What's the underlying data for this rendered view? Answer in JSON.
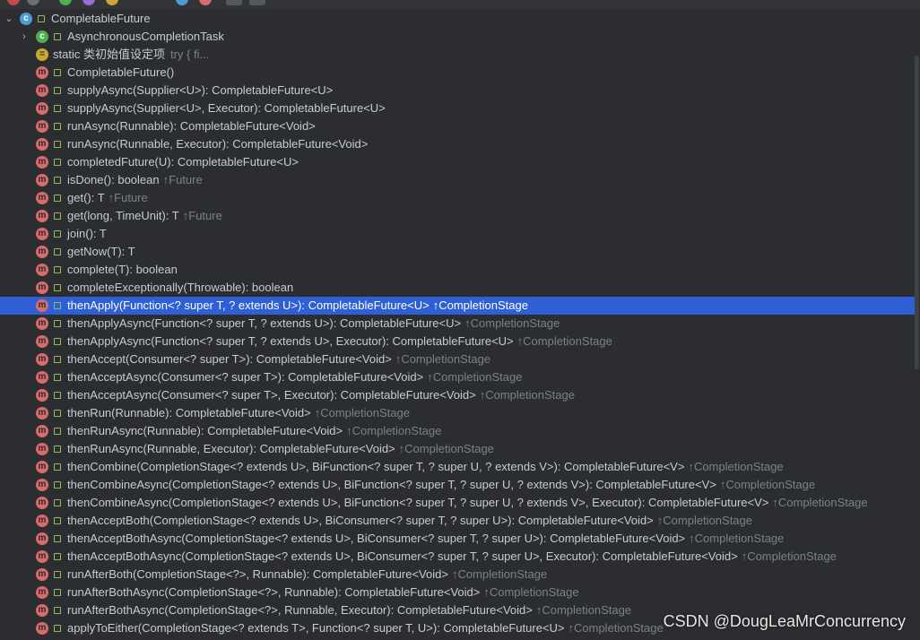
{
  "tree": {
    "root": {
      "label": "CompletableFuture",
      "icon": "class-icon"
    },
    "inner_class": {
      "label": "AsynchronousCompletionTask",
      "icon": "inner-class-icon"
    },
    "static_init": {
      "label": "static 类初始值设定项",
      "hint": "try {           fi..."
    },
    "members": [
      {
        "signature": "CompletableFuture()",
        "inherited": ""
      },
      {
        "signature": "supplyAsync(Supplier<U>): CompletableFuture<U>",
        "inherited": ""
      },
      {
        "signature": "supplyAsync(Supplier<U>, Executor): CompletableFuture<U>",
        "inherited": ""
      },
      {
        "signature": "runAsync(Runnable): CompletableFuture<Void>",
        "inherited": ""
      },
      {
        "signature": "runAsync(Runnable, Executor): CompletableFuture<Void>",
        "inherited": ""
      },
      {
        "signature": "completedFuture(U): CompletableFuture<U>",
        "inherited": ""
      },
      {
        "signature": "isDone(): boolean",
        "inherited": "↑Future"
      },
      {
        "signature": "get(): T",
        "inherited": "↑Future"
      },
      {
        "signature": "get(long, TimeUnit): T",
        "inherited": "↑Future"
      },
      {
        "signature": "join(): T",
        "inherited": ""
      },
      {
        "signature": "getNow(T): T",
        "inherited": ""
      },
      {
        "signature": "complete(T): boolean",
        "inherited": ""
      },
      {
        "signature": "completeExceptionally(Throwable): boolean",
        "inherited": ""
      },
      {
        "signature": "thenApply(Function<? super T, ? extends U>): CompletableFuture<U>",
        "inherited": "↑CompletionStage"
      },
      {
        "signature": "thenApplyAsync(Function<? super T, ? extends U>): CompletableFuture<U>",
        "inherited": "↑CompletionStage"
      },
      {
        "signature": "thenApplyAsync(Function<? super T, ? extends U>, Executor): CompletableFuture<U>",
        "inherited": "↑CompletionStage"
      },
      {
        "signature": "thenAccept(Consumer<? super T>): CompletableFuture<Void>",
        "inherited": "↑CompletionStage"
      },
      {
        "signature": "thenAcceptAsync(Consumer<? super T>): CompletableFuture<Void>",
        "inherited": "↑CompletionStage"
      },
      {
        "signature": "thenAcceptAsync(Consumer<? super T>, Executor): CompletableFuture<Void>",
        "inherited": "↑CompletionStage"
      },
      {
        "signature": "thenRun(Runnable): CompletableFuture<Void>",
        "inherited": "↑CompletionStage"
      },
      {
        "signature": "thenRunAsync(Runnable): CompletableFuture<Void>",
        "inherited": "↑CompletionStage"
      },
      {
        "signature": "thenRunAsync(Runnable, Executor): CompletableFuture<Void>",
        "inherited": "↑CompletionStage"
      },
      {
        "signature": "thenCombine(CompletionStage<? extends U>, BiFunction<? super T, ? super U, ? extends V>): CompletableFuture<V>",
        "inherited": "↑CompletionStage"
      },
      {
        "signature": "thenCombineAsync(CompletionStage<? extends U>, BiFunction<? super T, ? super U, ? extends V>): CompletableFuture<V>",
        "inherited": "↑CompletionStage"
      },
      {
        "signature": "thenCombineAsync(CompletionStage<? extends U>, BiFunction<? super T, ? super U, ? extends V>, Executor): CompletableFuture<V>",
        "inherited": "↑CompletionStage"
      },
      {
        "signature": "thenAcceptBoth(CompletionStage<? extends U>, BiConsumer<? super T, ? super U>): CompletableFuture<Void>",
        "inherited": "↑CompletionStage"
      },
      {
        "signature": "thenAcceptBothAsync(CompletionStage<? extends U>, BiConsumer<? super T, ? super U>): CompletableFuture<Void>",
        "inherited": "↑CompletionStage"
      },
      {
        "signature": "thenAcceptBothAsync(CompletionStage<? extends U>, BiConsumer<? super T, ? super U>, Executor): CompletableFuture<Void>",
        "inherited": "↑CompletionStage"
      },
      {
        "signature": "runAfterBoth(CompletionStage<?>, Runnable): CompletableFuture<Void>",
        "inherited": "↑CompletionStage"
      },
      {
        "signature": "runAfterBothAsync(CompletionStage<?>, Runnable): CompletableFuture<Void>",
        "inherited": "↑CompletionStage"
      },
      {
        "signature": "runAfterBothAsync(CompletionStage<?>, Runnable, Executor): CompletableFuture<Void>",
        "inherited": "↑CompletionStage"
      },
      {
        "signature": "applyToEither(CompletionStage<? extends T>, Function<? super T, U>): CompletableFuture<U>",
        "inherited": "↑CompletionStage"
      }
    ],
    "selected_member": "thenApply(Function<? super T, ? extends U>): CompletableFuture<U>"
  },
  "icons": {
    "method_letter": "m",
    "class_letter": "c",
    "init_letter": "="
  },
  "colors": {
    "background": "#2b2d30",
    "selection": "#2e5fd5",
    "method_icon": "#d86b6b",
    "muted_text": "#7c8189"
  },
  "watermark": "CSDN @DougLeaMrConcurrency"
}
